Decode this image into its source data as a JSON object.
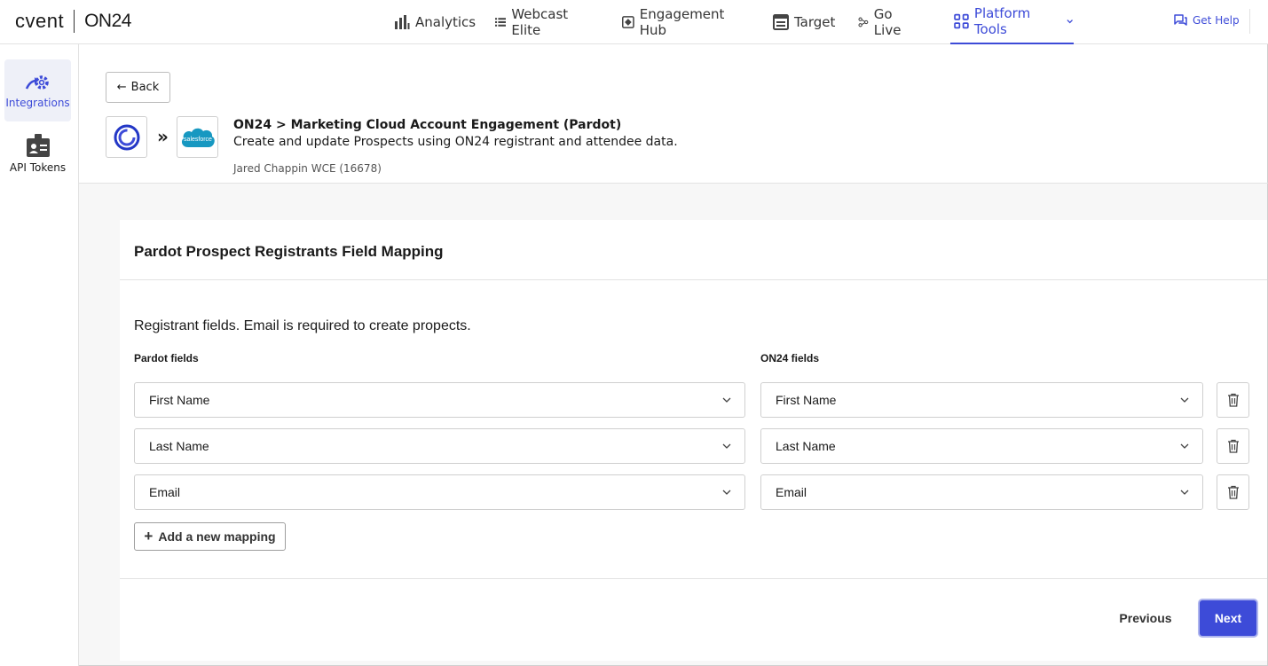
{
  "brand": {
    "left": "cvent",
    "right": "ON24"
  },
  "nav": {
    "items": [
      {
        "label": "Analytics",
        "icon": "bar-chart-icon"
      },
      {
        "label": "Webcast Elite",
        "icon": "list-icon"
      },
      {
        "label": "Engagement Hub",
        "icon": "engagement-hub-icon"
      },
      {
        "label": "Target",
        "icon": "target-page-icon"
      },
      {
        "label": "Go Live",
        "icon": "go-live-icon"
      },
      {
        "label": "Platform Tools",
        "icon": "grid-icon",
        "active": true
      }
    ],
    "help": "Get Help"
  },
  "sidebar": {
    "items": [
      {
        "label": "Integrations",
        "icon": "integrations-gear-icon",
        "active": true
      },
      {
        "label": "API Tokens",
        "icon": "id-badge-icon"
      }
    ]
  },
  "header": {
    "back_label": "Back",
    "title": "ON24 > Marketing Cloud Account Engagement (Pardot)",
    "description": "Create and update Prospects using ON24 registrant and attendee data.",
    "account": "Jared Chappin WCE (16678)",
    "target_logo_text": "salesforce"
  },
  "mapping": {
    "title": "Pardot Prospect Registrants Field Mapping",
    "subtitle": "Registrant fields. Email is required to create propects.",
    "left_col_label": "Pardot fields",
    "right_col_label": "ON24 fields",
    "rows": [
      {
        "pardot": "First Name",
        "on24": "First Name"
      },
      {
        "pardot": "Last Name",
        "on24": "Last Name"
      },
      {
        "pardot": "Email",
        "on24": "Email"
      }
    ],
    "add_label": "Add a new mapping"
  },
  "footer": {
    "previous_label": "Previous",
    "next_label": "Next"
  },
  "colors": {
    "accent": "#3d4bd8",
    "salesforce": "#1798c1"
  }
}
